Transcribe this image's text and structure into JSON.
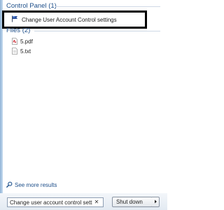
{
  "colors": {
    "header_text": "#1e4f8a",
    "highlight_border": "#000000",
    "panel_edge": "#8fb3d6"
  },
  "groups": {
    "control_panel": {
      "header": "Control Panel (1)",
      "items": [
        {
          "label": "Change User Account Control settings",
          "icon": "uac-flag-icon"
        }
      ]
    },
    "files": {
      "header": "Files (2)",
      "items": [
        {
          "label": "5.pdf",
          "icon": "pdf-file-icon"
        },
        {
          "label": "5.txt",
          "icon": "text-file-icon"
        }
      ]
    }
  },
  "see_more": {
    "label": "See more results",
    "icon": "search-icon"
  },
  "search": {
    "value": "Change user account control setting",
    "clear_icon": "close-icon"
  },
  "shutdown": {
    "label": "Shut down",
    "arrow_icon": "chevron-right-icon"
  }
}
